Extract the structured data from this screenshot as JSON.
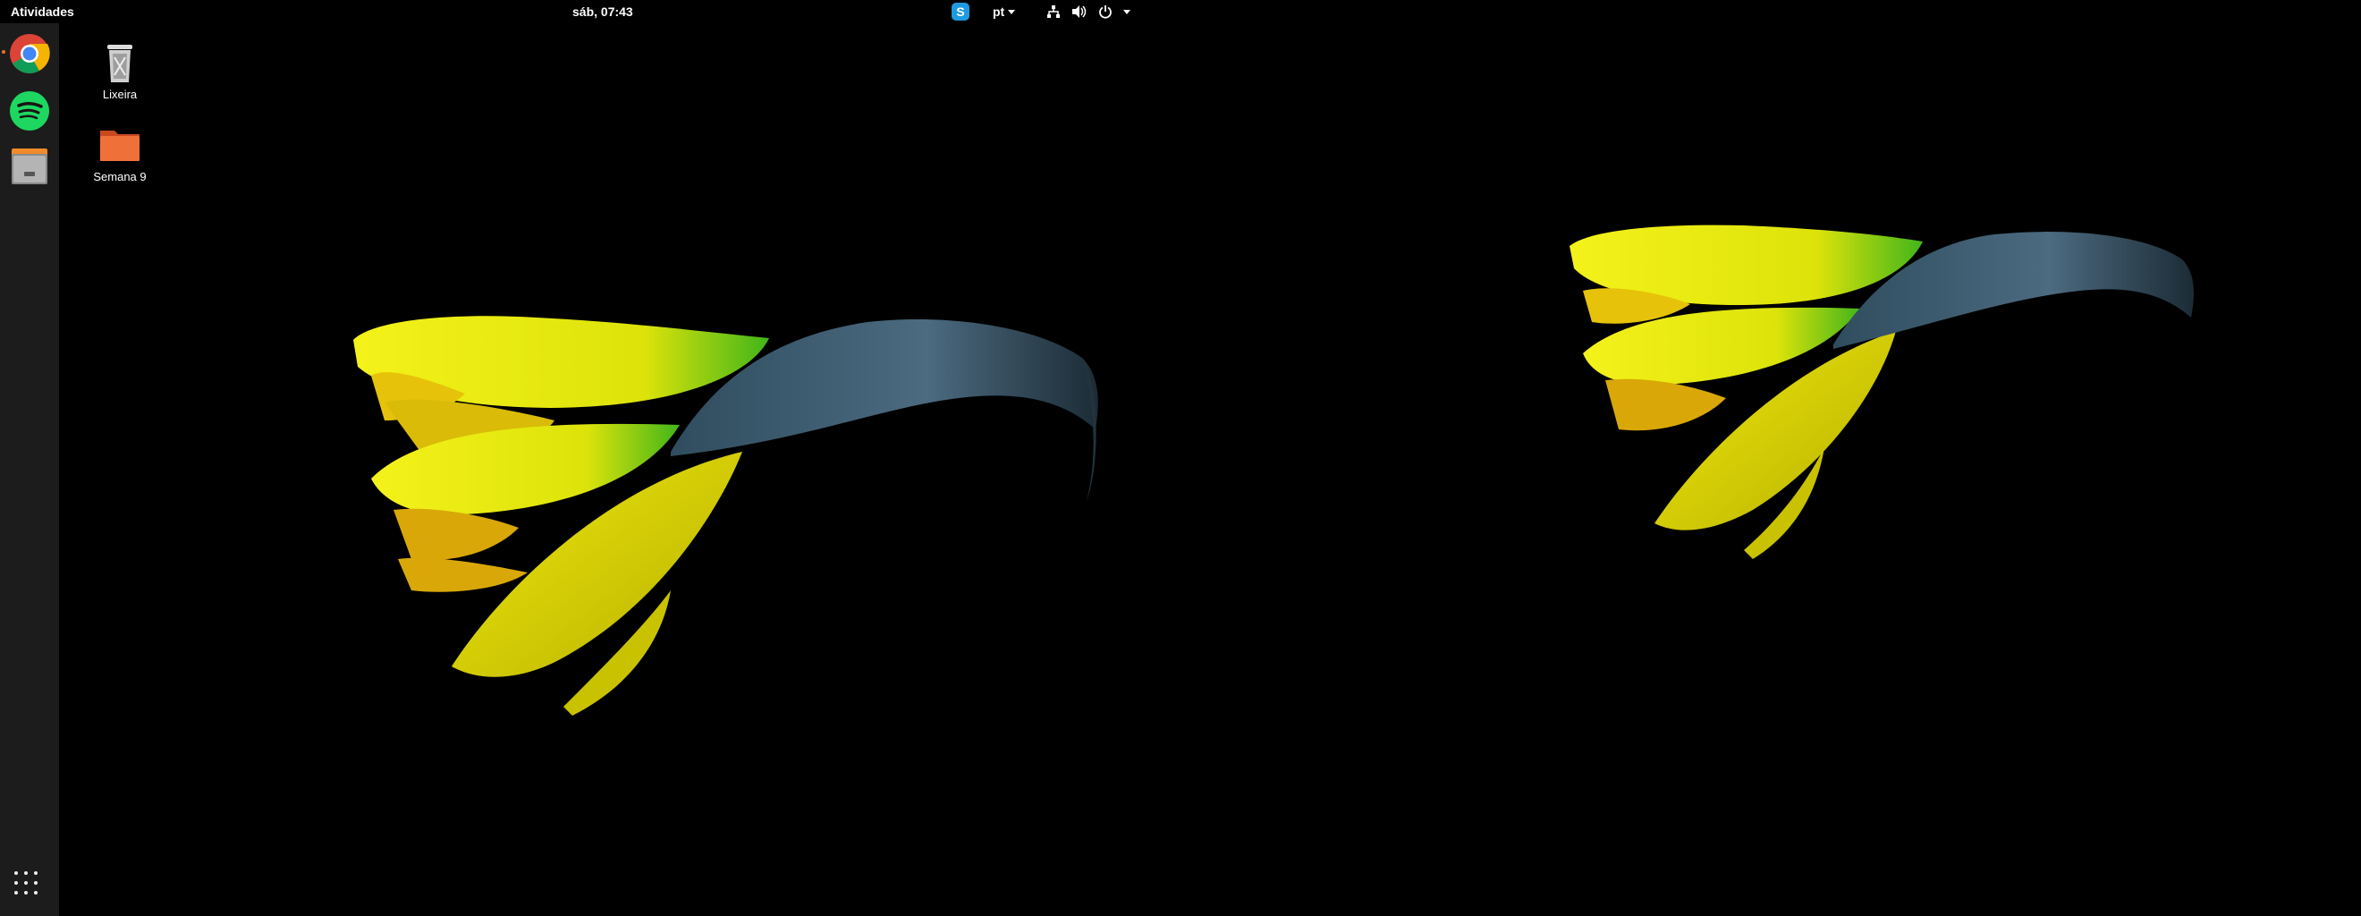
{
  "topbar": {
    "activities_label": "Atividades",
    "clock": "sáb, 07:43",
    "language": "pt",
    "skype_icon": "skype-icon",
    "network_icon": "network-icon",
    "volume_icon": "volume-icon",
    "power_icon": "power-icon"
  },
  "dock": {
    "items": [
      {
        "name": "chrome",
        "icon": "chrome-icon",
        "running": true
      },
      {
        "name": "spotify",
        "icon": "spotify-icon",
        "running": false
      },
      {
        "name": "files",
        "icon": "archive-icon",
        "running": false
      }
    ],
    "show_apps_icon": "grid-icon"
  },
  "desktop": {
    "icons": [
      {
        "label": "Lixeira",
        "icon": "trash-icon"
      },
      {
        "label": "Semana 9",
        "icon": "folder-icon"
      }
    ]
  },
  "colors": {
    "dock_bg": "#1c1c1c",
    "running_dot": "#f36f21",
    "folder": "#e85a2a",
    "petal": "#e6e80a",
    "stem": "#3a5a70"
  }
}
